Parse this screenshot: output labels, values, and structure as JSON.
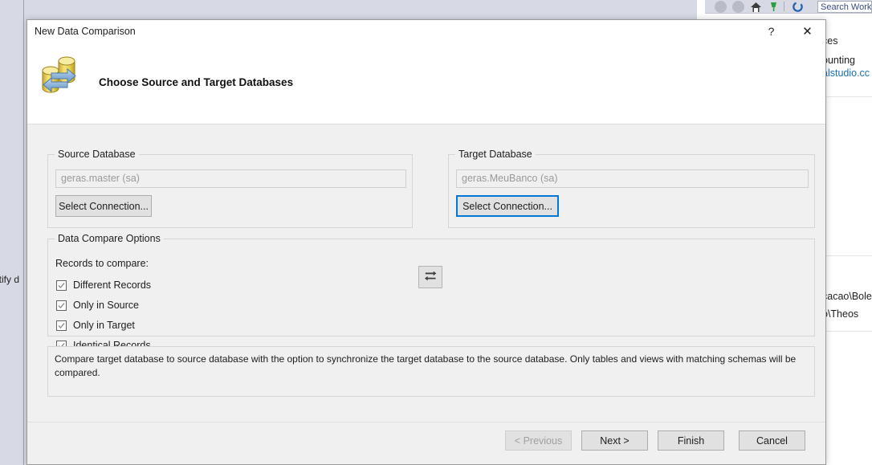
{
  "background": {
    "left_text": "ntify d",
    "toolbar": {
      "back_icon": "back-arrow-icon",
      "forward_icon": "forward-arrow-icon",
      "home_icon": "home-icon",
      "plug_icon": "plug-icon",
      "refresh_icon": "refresh-icon",
      "search_placeholder": "Search Work"
    },
    "panel_texts": [
      "ces",
      "ounting",
      "alstudio.cc",
      "cacao\\Bole",
      "o\\Theos"
    ]
  },
  "dialog": {
    "title": "New Data Comparison",
    "help_label": "?",
    "close_label": "✕",
    "header_icon": "database-compare-icon",
    "heading": "Choose Source and Target Databases",
    "source": {
      "legend": "Source Database",
      "connection_value": "geras.master (sa)",
      "select_button": "Select Connection..."
    },
    "swap_button_icon": "swap-arrows-icon",
    "target": {
      "legend": "Target Database",
      "connection_value": "geras.MeuBanco (sa)",
      "select_button": "Select Connection..."
    },
    "options": {
      "legend": "Data Compare Options",
      "records_label": "Records to compare:",
      "checkboxes": [
        {
          "label": "Different Records",
          "checked": true
        },
        {
          "label": "Only in Source",
          "checked": true
        },
        {
          "label": "Only in Target",
          "checked": true
        },
        {
          "label": "Identical Records",
          "checked": true
        }
      ]
    },
    "description": "Compare target database to source database with the option to synchronize the target database to the source database. Only tables and views with matching schemas will be compared.",
    "footer": {
      "previous": "< Previous",
      "next": "Next >",
      "finish": "Finish",
      "cancel": "Cancel"
    }
  },
  "colors": {
    "accent": "#0078d7",
    "dialog_bg": "#f0f0f0",
    "shell_bg": "#d7dae4"
  }
}
